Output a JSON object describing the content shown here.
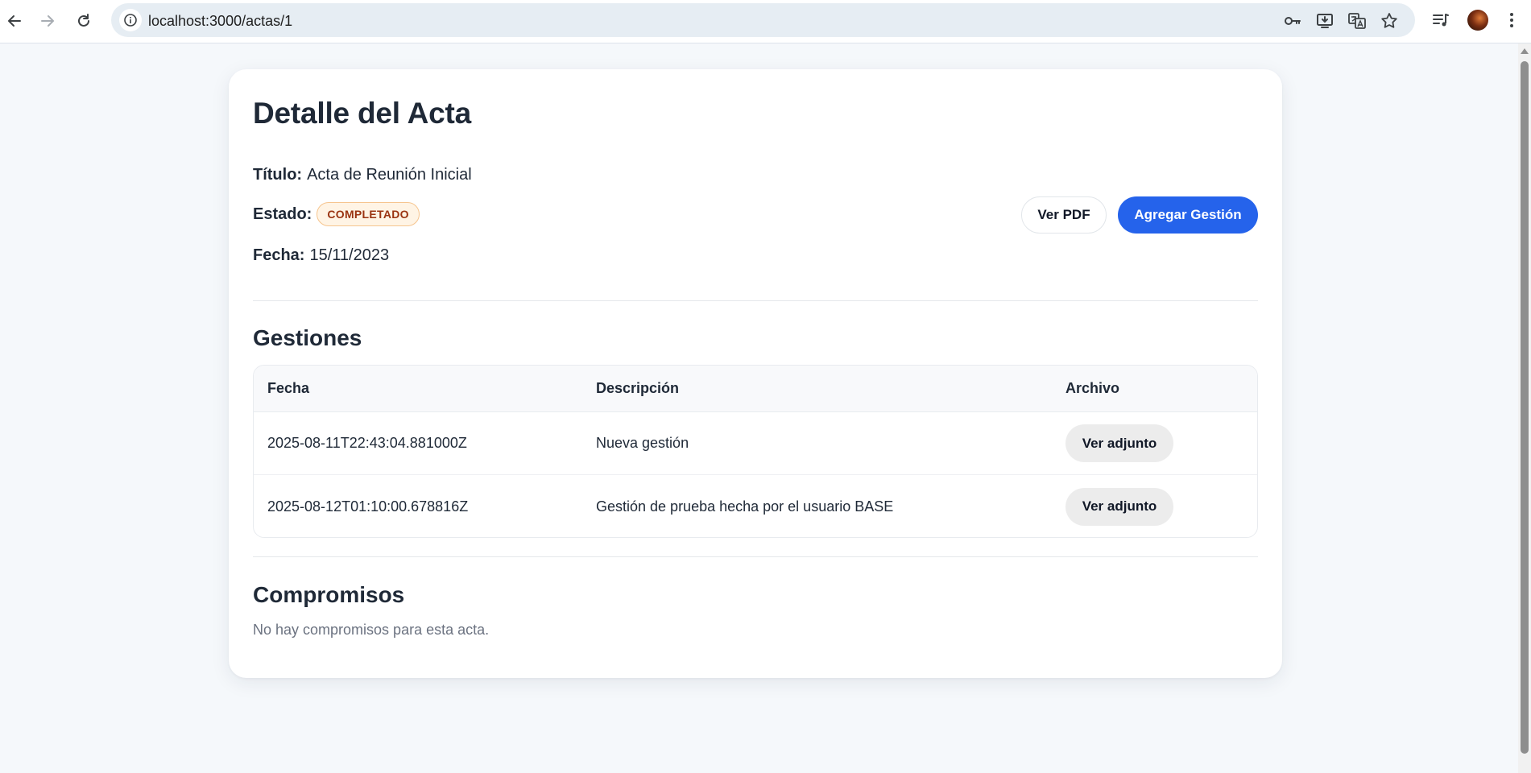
{
  "browser": {
    "url": "localhost:3000/actas/1"
  },
  "page": {
    "title": "Detalle del Acta",
    "titulo_label": "Título:",
    "titulo_value": "Acta de Reunión Inicial",
    "estado_label": "Estado:",
    "estado_value": "COMPLETADO",
    "fecha_label": "Fecha:",
    "fecha_value": "15/11/2023",
    "ver_pdf_label": "Ver PDF",
    "agregar_gestion_label": "Agregar Gestión"
  },
  "gestiones": {
    "title": "Gestiones",
    "columns": [
      "Fecha",
      "Descripción",
      "Archivo"
    ],
    "rows": [
      {
        "fecha": "2025-08-11T22:43:04.881000Z",
        "descripcion": "Nueva gestión",
        "archivo_label": "Ver adjunto"
      },
      {
        "fecha": "2025-08-12T01:10:00.678816Z",
        "descripcion": "Gestión de prueba hecha por el usuario BASE",
        "archivo_label": "Ver adjunto"
      }
    ]
  },
  "compromisos": {
    "title": "Compromisos",
    "empty_text": "No hay compromisos para esta acta."
  },
  "colors": {
    "primary": "#2563eb",
    "badge_bg": "#fff4e5",
    "badge_text": "#9a3412"
  },
  "icons": [
    "back-arrow-icon",
    "forward-arrow-icon",
    "reload-icon",
    "site-info-icon",
    "password-key-icon",
    "install-app-icon",
    "translate-icon",
    "bookmark-star-icon",
    "media-control-icon",
    "profile-avatar",
    "kebab-menu-icon"
  ]
}
